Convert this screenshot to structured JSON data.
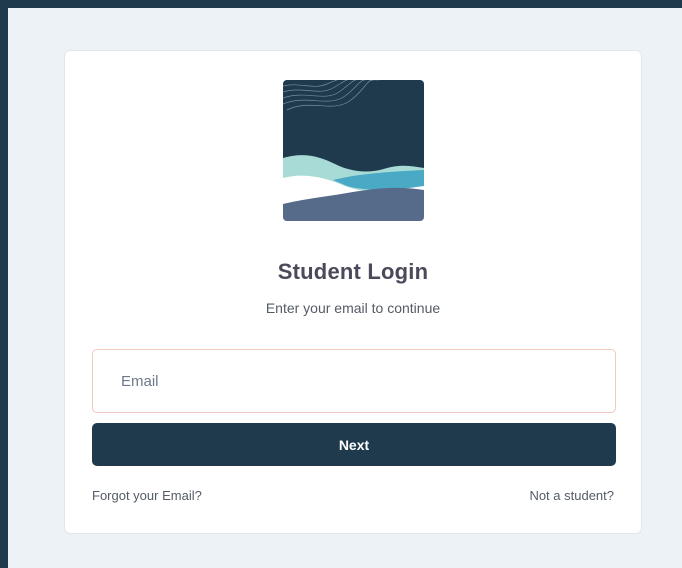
{
  "login": {
    "title": "Student Login",
    "subtitle": "Enter your email to continue",
    "email_placeholder": "Email",
    "email_value": "",
    "next_label": "Next",
    "forgot_label": "Forgot your Email?",
    "not_student_label": "Not a student?"
  },
  "logo": {
    "icon": "wave-landscape-logo",
    "colors": {
      "background": "#1f3a4d",
      "teal_light": "#a8dbd6",
      "blue": "#4aa9c4",
      "slate": "#566a8a",
      "white": "#ffffff"
    }
  },
  "colors": {
    "frame": "#1f3a4d",
    "page_bg": "#edf2f7",
    "card_bg": "#ffffff",
    "primary_button": "#1f3a4d",
    "input_border": "#f1c9bf",
    "title_text": "#4a4a5a"
  }
}
